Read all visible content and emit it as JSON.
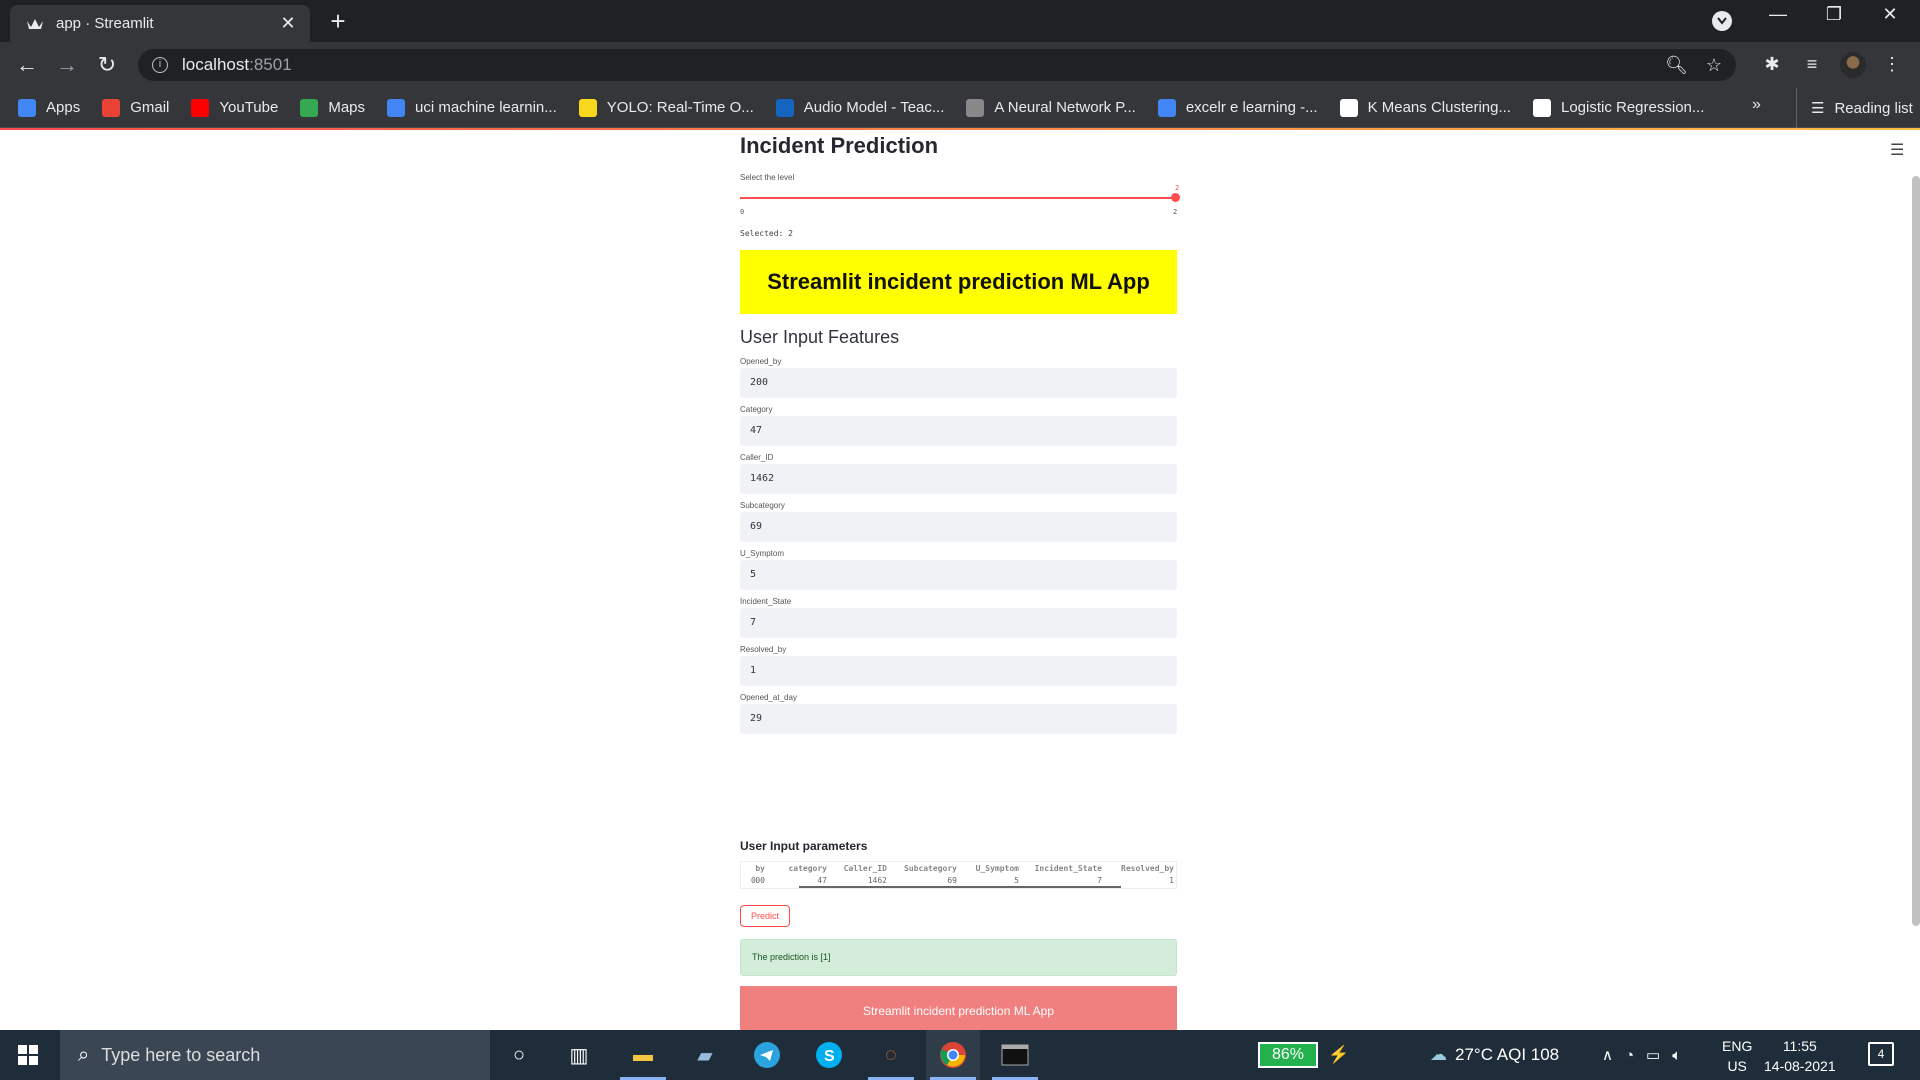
{
  "browser": {
    "tab_title": "app · Streamlit",
    "url_host": "localhost",
    "url_port": ":8501",
    "bookmarks": [
      {
        "label": "Apps",
        "icon": "apps-grid-icon",
        "color": "#4285f4"
      },
      {
        "label": "Gmail",
        "icon": "gmail-icon",
        "color": "#ea4335"
      },
      {
        "label": "YouTube",
        "icon": "youtube-icon",
        "color": "#ff0000"
      },
      {
        "label": "Maps",
        "icon": "maps-icon",
        "color": "#34a853"
      },
      {
        "label": "uci machine learnin...",
        "icon": "google-icon",
        "color": "#4285f4"
      },
      {
        "label": "YOLO: Real-Time O...",
        "icon": "pj-icon",
        "color": "#f9d71c"
      },
      {
        "label": "Audio Model - Teac...",
        "icon": "tm-icon",
        "color": "#1565c0"
      },
      {
        "label": "A Neural Network P...",
        "icon": "neural-icon",
        "color": "#888888"
      },
      {
        "label": "excelr e learning -...",
        "icon": "google-icon",
        "color": "#4285f4"
      },
      {
        "label": "K Means Clustering...",
        "icon": "chart-icon",
        "color": "#ffffff"
      },
      {
        "label": "Logistic Regression...",
        "icon": "diagram-icon",
        "color": "#ffffff"
      }
    ],
    "reading_list": "Reading list"
  },
  "app": {
    "title": "Incident Prediction",
    "slider": {
      "label": "Select the level",
      "value": "2",
      "min": "0",
      "max": "2",
      "fill_fraction": 1.0
    },
    "selected_text": "Selected: 2",
    "banner": "Streamlit incident prediction ML App",
    "section_title": "User Input Features",
    "fields": [
      {
        "label": "Opened_by",
        "value": "200"
      },
      {
        "label": "Category",
        "value": "47"
      },
      {
        "label": "Caller_ID",
        "value": "1462"
      },
      {
        "label": "Subcategory",
        "value": "69"
      },
      {
        "label": "U_Symptom",
        "value": "5"
      },
      {
        "label": "Incident_State",
        "value": "7"
      },
      {
        "label": "Resolved_by",
        "value": "1"
      },
      {
        "label": "Opened_at_day",
        "value": "29"
      }
    ],
    "params_title": "User Input parameters",
    "table": {
      "headers": [
        "by",
        "category",
        "Caller_ID",
        "Subcategory",
        "U_Symptom",
        "Incident_State",
        "Resolved_by"
      ],
      "row_index": "0",
      "row": [
        "00",
        "47",
        "1462",
        "69",
        "5",
        "7",
        "1"
      ]
    },
    "predict_label": "Predict",
    "prediction_text": "The prediction is [1]",
    "footer_banner": "Streamlit incident prediction ML App"
  },
  "taskbar": {
    "search_placeholder": "Type here to search",
    "battery": "86%",
    "weather": "27°C  AQI 108",
    "lang_top": "ENG",
    "lang_bottom": "US",
    "time": "11:55",
    "date": "14-08-2021",
    "notifications": "4"
  }
}
